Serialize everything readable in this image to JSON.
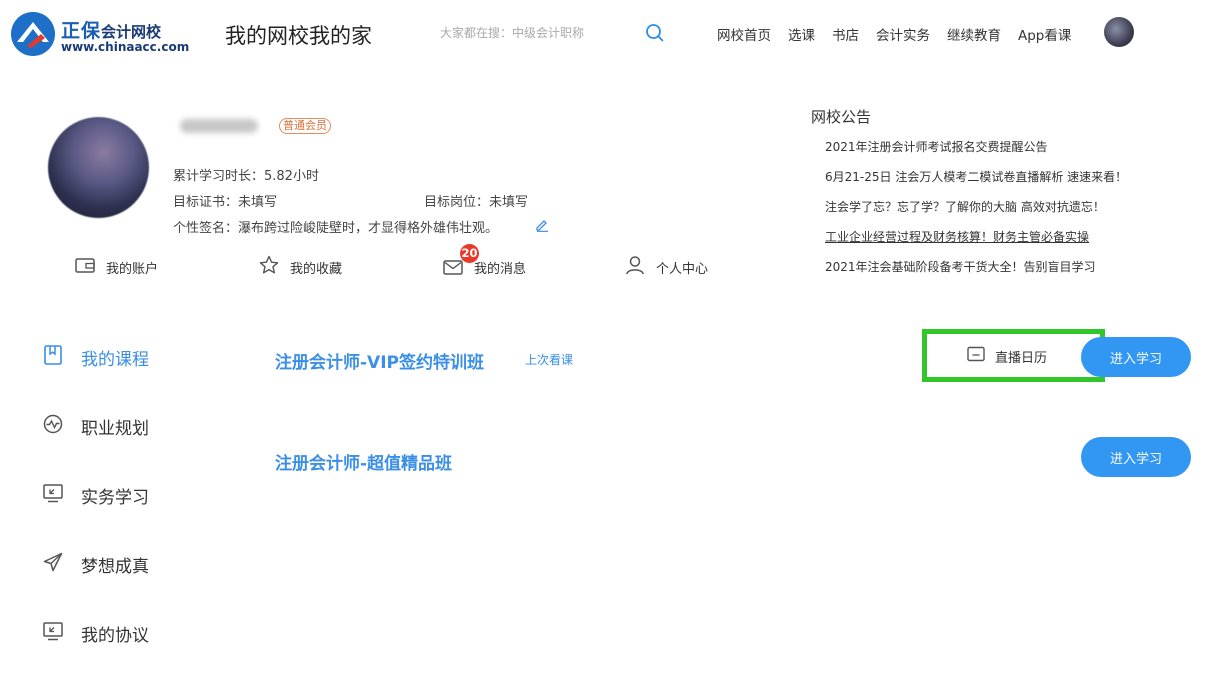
{
  "header": {
    "logo_brand": "正保",
    "logo_sub": "会计网校",
    "logo_url": "www.chinaacc.com",
    "slogan": "我的网校我的家",
    "search_placeholder": "大家都在搜：中级会计职称",
    "nav": [
      "网校首页",
      "选课",
      "书店",
      "会计实务",
      "继续教育",
      "App看课"
    ]
  },
  "profile": {
    "member_badge": "普通会员",
    "study_time": "累计学习时长：5.82小时",
    "target_cert": "目标证书：未填写",
    "target_job": "目标岗位：未填写",
    "signature": "个性签名：瀑布跨过险峻陡壁时，才显得格外雄伟壮观。",
    "quick_links": {
      "account": "我的账户",
      "favorites": "我的收藏",
      "messages": "我的消息",
      "message_count": "20",
      "personal_center": "个人中心"
    }
  },
  "announcements": {
    "title": "网校公告",
    "items": [
      "2021年注册会计师考试报名交费提醒公告",
      "6月21-25日 注会万人模考二模试卷直播解析 速速来看！",
      "注会学了忘？忘了学？了解你的大脑 高效对抗遗忘！",
      "工业企业经营过程及财务核算！财务主管必备实操",
      "2021年注会基础阶段备考干货大全！告别盲目学习"
    ]
  },
  "side_menu": {
    "my_courses": "我的课程",
    "career_plan": "职业规划",
    "practice": "实务学习",
    "dream": "梦想成真",
    "agreement": "我的协议"
  },
  "courses": {
    "course1": {
      "title": "注册会计师-VIP签约特训班",
      "last_watch": "上次看课",
      "calendar": "直播日历",
      "enter": "进入学习"
    },
    "course2": {
      "title": "注册会计师-超值精品班",
      "enter": "进入学习"
    }
  },
  "colors": {
    "accent": "#3b8fe7",
    "button": "#3296f3",
    "highlight_box": "#2fc729",
    "badge_red": "#e8392b",
    "member_badge": "#e0703a"
  }
}
